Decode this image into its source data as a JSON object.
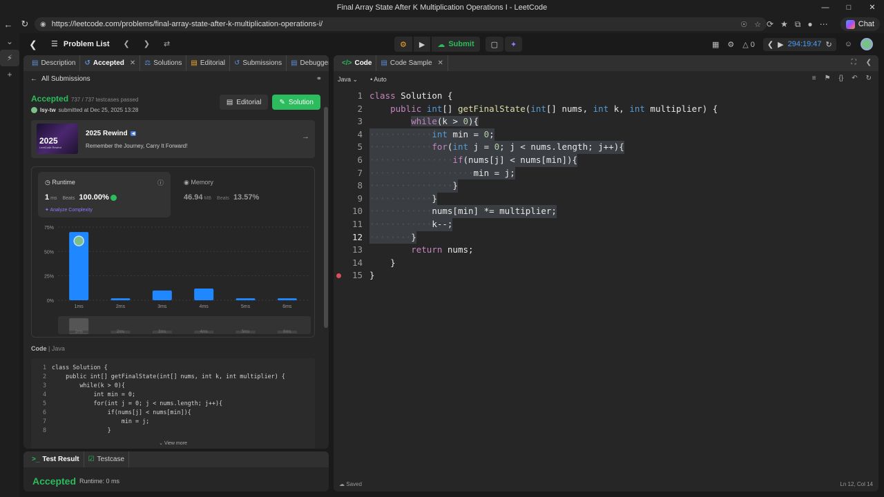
{
  "browser": {
    "window_title": "Final Array State After K Multiplication Operations I - LeetCode",
    "url": "https://leetcode.com/problems/final-array-state-after-k-multiplication-operations-i/",
    "chat_label": "Chat"
  },
  "topnav": {
    "problem_list": "Problem List",
    "submit_label": "Submit",
    "fire_count": "0",
    "timer": "294:19:47"
  },
  "left_tabs": [
    {
      "label": "Description"
    },
    {
      "label": "Accepted"
    },
    {
      "label": "Solutions"
    },
    {
      "label": "Editorial"
    },
    {
      "label": "Submissions"
    },
    {
      "label": "Debugger"
    }
  ],
  "submission": {
    "back_label": "All Submissions",
    "status": "Accepted",
    "testcases": "737 / 737 testcases passed",
    "user": "lsy-tw",
    "submitted_text": "submitted at Dec 25, 2025 13:28",
    "editorial_btn": "Editorial",
    "solution_btn": "Solution"
  },
  "rewind": {
    "image_year": "2025",
    "image_caption": "LeetCode Rewind",
    "title": "2025 Rewind",
    "subtitle": "Remember the Journey, Carry It Forward!"
  },
  "stats": {
    "runtime_label": "Runtime",
    "runtime_value": "1",
    "runtime_unit": "ms",
    "beats_label": "Beats",
    "runtime_beats": "100.00%",
    "analyze": "Analyze Complexity",
    "memory_label": "Memory",
    "memory_value": "46.94",
    "memory_unit": "MB",
    "memory_beats": "13.57%"
  },
  "chart_data": {
    "type": "bar",
    "categories": [
      "1ms",
      "2ms",
      "3ms",
      "4ms",
      "5ms",
      "6ms"
    ],
    "values": [
      70,
      2,
      10,
      12,
      2,
      2
    ],
    "ylim": [
      0,
      75
    ],
    "yticks": [
      "0%",
      "25%",
      "50%",
      "75%"
    ],
    "highlight_index": 0,
    "bar_color": "#1f87ff",
    "grid": true
  },
  "code_header": {
    "label": "Code",
    "lang": "Java"
  },
  "small_code": [
    "class Solution {",
    "    public int[] getFinalState(int[] nums, int k, int multiplier) {",
    "        while(k > 0){",
    "            int min = 0;",
    "            for(int j = 0; j < nums.length; j++){",
    "                if(nums[j] < nums[min]){",
    "                    min = j;",
    "                }"
  ],
  "view_more": "View more",
  "bottom": {
    "tab_result": "Test Result",
    "tab_testcase": "Testcase",
    "result": "Accepted",
    "runtime": "Runtime: 0 ms"
  },
  "right_tabs": {
    "code": "Code",
    "sample": "Code Sample"
  },
  "editor": {
    "language": "Java",
    "auto": "Auto",
    "saved": "Saved",
    "cursor": "Ln 12, Col 14"
  }
}
